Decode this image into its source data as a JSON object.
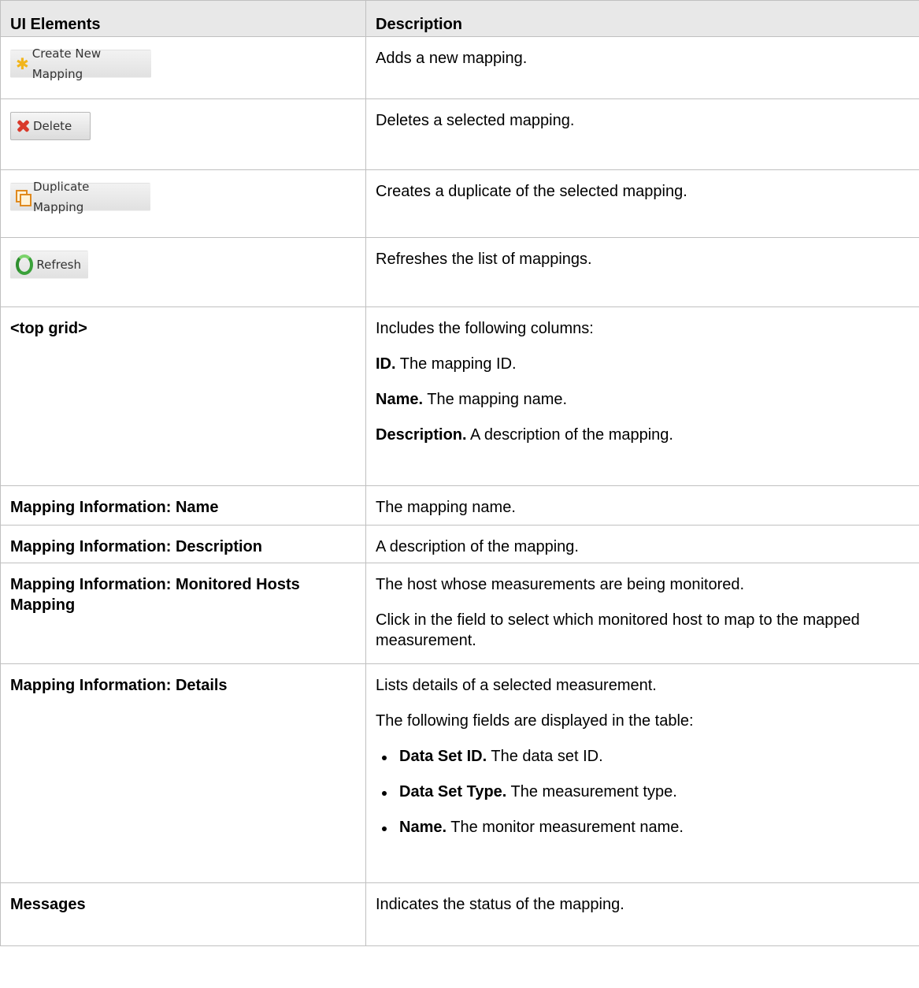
{
  "table": {
    "headers": {
      "col1": "UI Elements",
      "col2": "Description"
    },
    "rows": [
      {
        "element_type": "button",
        "element": "Create New Mapping",
        "icon": "star-icon",
        "description": "Adds a new mapping."
      },
      {
        "element_type": "button",
        "element": "Delete",
        "icon": "delete-x-icon",
        "description": "Deletes a selected mapping."
      },
      {
        "element_type": "button",
        "element": "Duplicate Mapping",
        "icon": "duplicate-icon",
        "description": "Creates a duplicate of the selected mapping."
      },
      {
        "element_type": "button",
        "element": "Refresh",
        "icon": "refresh-icon",
        "description": "Refreshes the list of mappings."
      },
      {
        "element_type": "label",
        "element": "<top grid>",
        "description": "Includes the following columns:",
        "items": [
          {
            "term": "ID.",
            "text": " The mapping ID."
          },
          {
            "term": "Name.",
            "text": " The mapping name."
          },
          {
            "term": "Description.",
            "text": " A description of the mapping."
          }
        ]
      },
      {
        "element_type": "label",
        "element": "Mapping Information: Name",
        "description": "The mapping name."
      },
      {
        "element_type": "label",
        "element": "Mapping Information: Description",
        "description": "A description of the mapping."
      },
      {
        "element_type": "label",
        "element": "Mapping Information: Monitored Hosts Mapping",
        "description": "The host whose measurements are being monitored.",
        "description_2": "Click in the field to select which monitored host to map to the mapped measurement."
      },
      {
        "element_type": "label",
        "element": "Mapping Information: Details",
        "description": "Lists details of a selected measurement.",
        "description_2": "The following fields are displayed in the table:",
        "bullets": [
          {
            "term": "Data Set ID.",
            "text": " The data set ID."
          },
          {
            "term": "Data Set Type.",
            "text": " The measurement type."
          },
          {
            "term": "Name.",
            "text": " The monitor measurement name."
          }
        ]
      },
      {
        "element_type": "label",
        "element": "Messages",
        "description": "Indicates the status of the mapping."
      }
    ]
  }
}
